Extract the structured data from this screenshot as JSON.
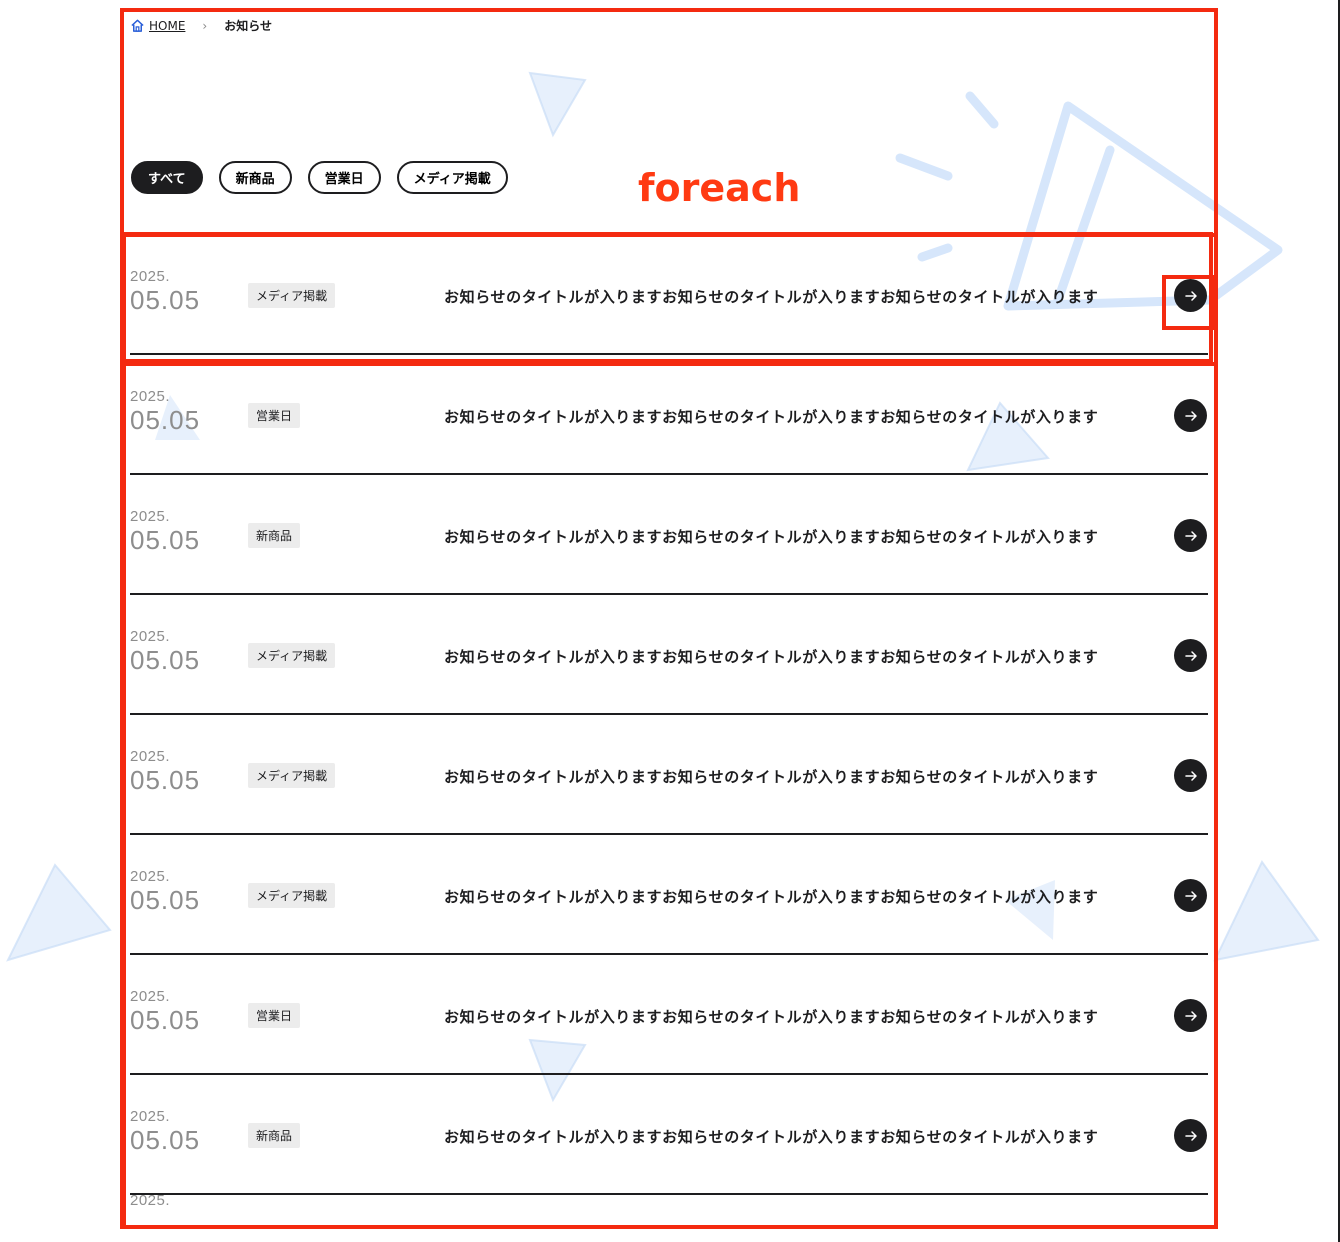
{
  "breadcrumb": {
    "home_label": "HOME",
    "separator": "›",
    "current_label": "お知らせ"
  },
  "filters": [
    {
      "label": "すべて",
      "active": true
    },
    {
      "label": "新商品",
      "active": false
    },
    {
      "label": "営業日",
      "active": false
    },
    {
      "label": "メディア掲載",
      "active": false
    }
  ],
  "annotation": {
    "label": "foreach",
    "color": "#f42a10"
  },
  "news": [
    {
      "year": "2025.",
      "day": "05.05",
      "category": "メディア掲載",
      "title": "お知らせのタイトルが入りますお知らせのタイトルが入りますお知らせのタイトルが入ります"
    },
    {
      "year": "2025.",
      "day": "05.05",
      "category": "営業日",
      "title": "お知らせのタイトルが入りますお知らせのタイトルが入りますお知らせのタイトルが入ります"
    },
    {
      "year": "2025.",
      "day": "05.05",
      "category": "新商品",
      "title": "お知らせのタイトルが入りますお知らせのタイトルが入りますお知らせのタイトルが入ります"
    },
    {
      "year": "2025.",
      "day": "05.05",
      "category": "メディア掲載",
      "title": "お知らせのタイトルが入りますお知らせのタイトルが入りますお知らせのタイトルが入ります"
    },
    {
      "year": "2025.",
      "day": "05.05",
      "category": "メディア掲載",
      "title": "お知らせのタイトルが入りますお知らせのタイトルが入りますお知らせのタイトルが入ります"
    },
    {
      "year": "2025.",
      "day": "05.05",
      "category": "メディア掲載",
      "title": "お知らせのタイトルが入りますお知らせのタイトルが入りますお知らせのタイトルが入ります"
    },
    {
      "year": "2025.",
      "day": "05.05",
      "category": "営業日",
      "title": "お知らせのタイトルが入りますお知らせのタイトルが入りますお知らせのタイトルが入ります"
    },
    {
      "year": "2025.",
      "day": "05.05",
      "category": "新商品",
      "title": "お知らせのタイトルが入りますお知らせのタイトルが入りますお知らせのタイトルが入ります"
    }
  ],
  "partial_year": "2025.",
  "icons": {
    "home": "home-icon",
    "arrow": "arrow-right-icon"
  },
  "colors": {
    "text": "#1d1d1f",
    "date": "#8d8d8d",
    "badge_bg": "#ececec",
    "accent_deco": "#dbeafe"
  }
}
